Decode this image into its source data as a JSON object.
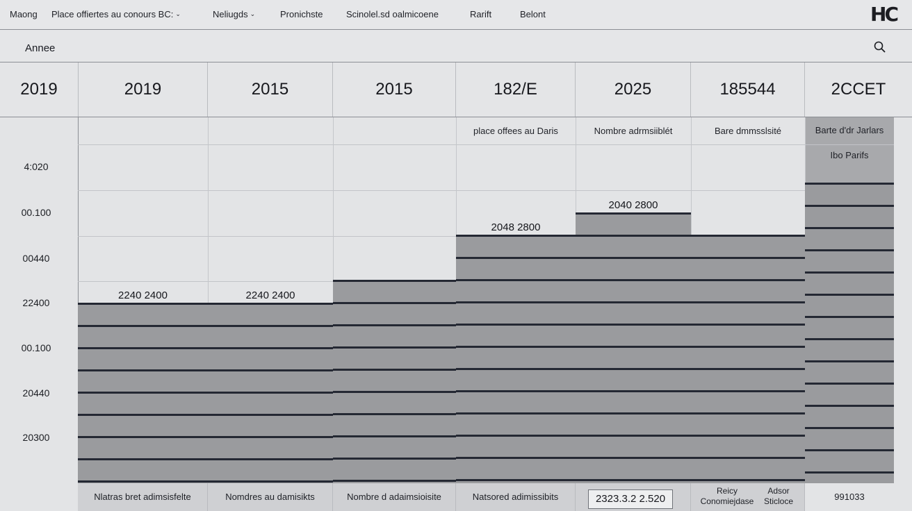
{
  "nav": {
    "items": [
      {
        "label": "Maong",
        "chevron": false
      },
      {
        "label": "Place offiertes au conours BC:",
        "chevron": true
      },
      {
        "label": "Neliugds",
        "chevron": true
      },
      {
        "label": "Pronichste",
        "chevron": false
      },
      {
        "label": "Scinolel.sd oalmicoene",
        "chevron": false
      },
      {
        "label": "Rarift",
        "chevron": false
      },
      {
        "label": "Belont",
        "chevron": false
      }
    ],
    "chevron_glyph": "⌄",
    "logo": "HC"
  },
  "filter": {
    "label": "Annee",
    "icon": "search-icon"
  },
  "header": {
    "years": [
      "2019",
      "2019",
      "2015",
      "2015",
      "182/E",
      "2025",
      "185544",
      "2CCET"
    ]
  },
  "chart_data": {
    "type": "bar",
    "y_tick_labels": [
      "4:020",
      "00.100",
      "00440",
      "22400",
      "00.100",
      "20440",
      "20300"
    ],
    "categories": [
      "2019",
      "2015",
      "2015",
      "182/E",
      "2025",
      "185544",
      "2CCET"
    ],
    "values": [
      8.0,
      8.0,
      9.0,
      11.0,
      12.0,
      11.0,
      13.3
    ],
    "ylim": [
      0,
      16.2
    ],
    "bar_labels": [
      "2240 2400",
      "2240 2400",
      "",
      "2048 2800",
      "2040 2800",
      "",
      ""
    ],
    "column_captions": [
      "",
      "",
      "",
      "place offees au Daris",
      "Nombre adrmsiiblét",
      "Bare dmmsslsité",
      "Barte d'dr Jarlars"
    ],
    "extra_caption": "Ibo Parifs",
    "grid": true
  },
  "footer": {
    "cells": [
      "Nlatras bret adimsisfelte",
      "Nomdres au damisikts",
      "Nombre d adaimsioisite",
      "Natsored adimissibits"
    ],
    "input_value": "2323.3.2 2.520",
    "small_left_line1": "Reicy",
    "small_left_line2": "Conomiejdase",
    "small_right_line1": "Adsor",
    "small_right_line2": "Sticloce",
    "last_value": "991033"
  },
  "colors": {
    "bar_fill": "#9a9b9e",
    "bar_stripe": "#242833",
    "background": "#e3e4e6"
  }
}
